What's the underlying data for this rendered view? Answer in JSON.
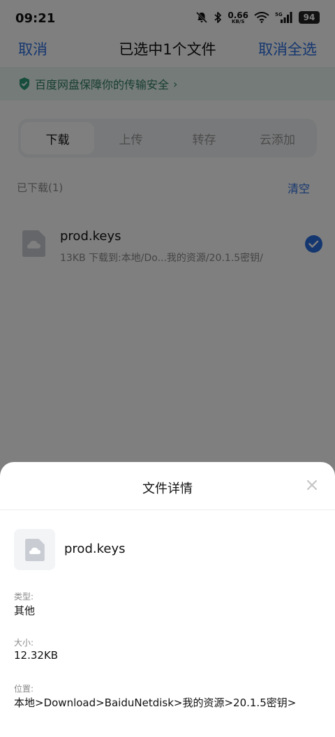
{
  "status_bar": {
    "time": "09:21",
    "net_speed": "0.66",
    "net_unit": "KB/S",
    "network": "5G",
    "battery": "94"
  },
  "header": {
    "cancel": "取消",
    "title": "已选中1个文件",
    "deselect_all": "取消全选"
  },
  "security_banner": {
    "text": "百度网盘保障你的传输安全",
    "color": "#2f7d64"
  },
  "tabs": [
    {
      "label": "下载",
      "active": true
    },
    {
      "label": "上传",
      "active": false
    },
    {
      "label": "转存",
      "active": false
    },
    {
      "label": "云添加",
      "active": false
    }
  ],
  "section": {
    "title": "已下载(1)",
    "clear": "清空"
  },
  "file": {
    "name": "prod.keys",
    "subtitle": "13KB 下载到:本地/Do...我的资源/20.1.5密钥/",
    "selected": true
  },
  "sheet": {
    "title": "文件详情",
    "file_name": "prod.keys",
    "type_label": "类型:",
    "type_value": "其他",
    "size_label": "大小:",
    "size_value": "12.32KB",
    "location_label": "位置:",
    "location_value": "本地>Download>BaiduNetdisk>我的资源>20.1.5密钥>"
  },
  "colors": {
    "accent": "#2a6ee0",
    "overlay": "rgba(0,0,0,0.5)"
  }
}
